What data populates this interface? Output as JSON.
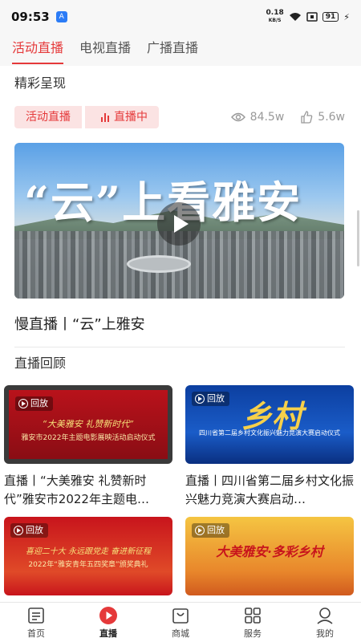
{
  "status_bar": {
    "time": "09:53",
    "speed_value": "0.18",
    "speed_unit": "KB/S",
    "battery": "91"
  },
  "tabs": [
    {
      "label": "活动直播",
      "active": true
    },
    {
      "label": "电视直播",
      "active": false
    },
    {
      "label": "广播直播",
      "active": false
    }
  ],
  "featured": {
    "section_title": "精彩呈现",
    "tag_category": "活动直播",
    "tag_status": "直播中",
    "views": "84.5w",
    "likes": "5.6w",
    "hero_text": "“云”上看雅安",
    "title": "慢直播丨“云”上雅安"
  },
  "review": {
    "section_title": "直播回顾",
    "badge_label": "回放",
    "items": [
      {
        "title": "直播丨“大美雅安 礼赞新时代”雅安市2022年主题电…",
        "thumb_caption": "“大美雅安 礼赞新时代”",
        "thumb_sub": "雅安市2022年主题电影展映活动启动仪式"
      },
      {
        "title": "直播丨四川省第二届乡村文化振兴魅力竞演大赛启动…",
        "thumb_caption": "乡村",
        "thumb_sub": "四川省第二届乡村文化振兴魅力竞演大赛启动仪式"
      },
      {
        "title": "",
        "thumb_caption": "喜迎二十大 永远跟党走 奋进新征程",
        "thumb_sub": "2022年“雅安青年五四奖章”颁奖典礼"
      },
      {
        "title": "",
        "thumb_caption": "大美雅安·多彩乡村",
        "thumb_sub": ""
      }
    ]
  },
  "bottom_nav": [
    {
      "label": "首页",
      "icon": "home-icon",
      "active": false
    },
    {
      "label": "直播",
      "icon": "live-play-icon",
      "active": true
    },
    {
      "label": "商城",
      "icon": "shop-icon",
      "active": false
    },
    {
      "label": "服务",
      "icon": "services-grid-icon",
      "active": false
    },
    {
      "label": "我的",
      "icon": "profile-icon",
      "active": false
    }
  ],
  "colors": {
    "accent": "#e5393a",
    "tag_bg": "#fbe3e3"
  }
}
